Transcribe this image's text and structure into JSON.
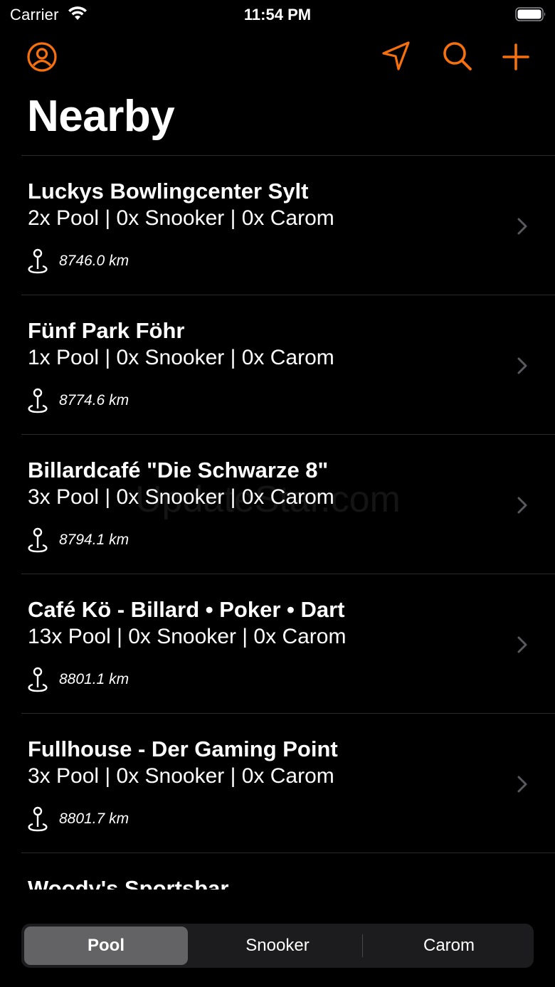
{
  "status_bar": {
    "carrier": "Carrier",
    "time": "11:54 PM"
  },
  "nav": {
    "title": "Nearby",
    "icons": [
      "profile-icon",
      "location-arrow-icon",
      "search-icon",
      "plus-icon"
    ],
    "accent": "#F7700E"
  },
  "venues": [
    {
      "name": "Luckys Bowlingcenter Sylt",
      "tables": "2x Pool | 0x Snooker | 0x Carom",
      "distance": "8746.0 km"
    },
    {
      "name": "Fünf Park Föhr",
      "tables": "1x Pool | 0x Snooker | 0x Carom",
      "distance": "8774.6 km"
    },
    {
      "name": "Billardcafé \"Die Schwarze 8\"",
      "tables": "3x Pool | 0x Snooker | 0x Carom",
      "distance": "8794.1 km"
    },
    {
      "name": "Café Kö - Billard • Poker • Dart",
      "tables": "13x Pool | 0x Snooker | 0x Carom",
      "distance": "8801.1 km"
    },
    {
      "name": "Fullhouse - Der Gaming Point",
      "tables": "3x Pool | 0x Snooker | 0x Carom",
      "distance": "8801.7 km"
    },
    {
      "name": "Woody's Sportsbar"
    }
  ],
  "segments": {
    "items": [
      "Pool",
      "Snooker",
      "Carom"
    ],
    "selected": "Pool"
  },
  "watermark": "UpdateStar.com"
}
